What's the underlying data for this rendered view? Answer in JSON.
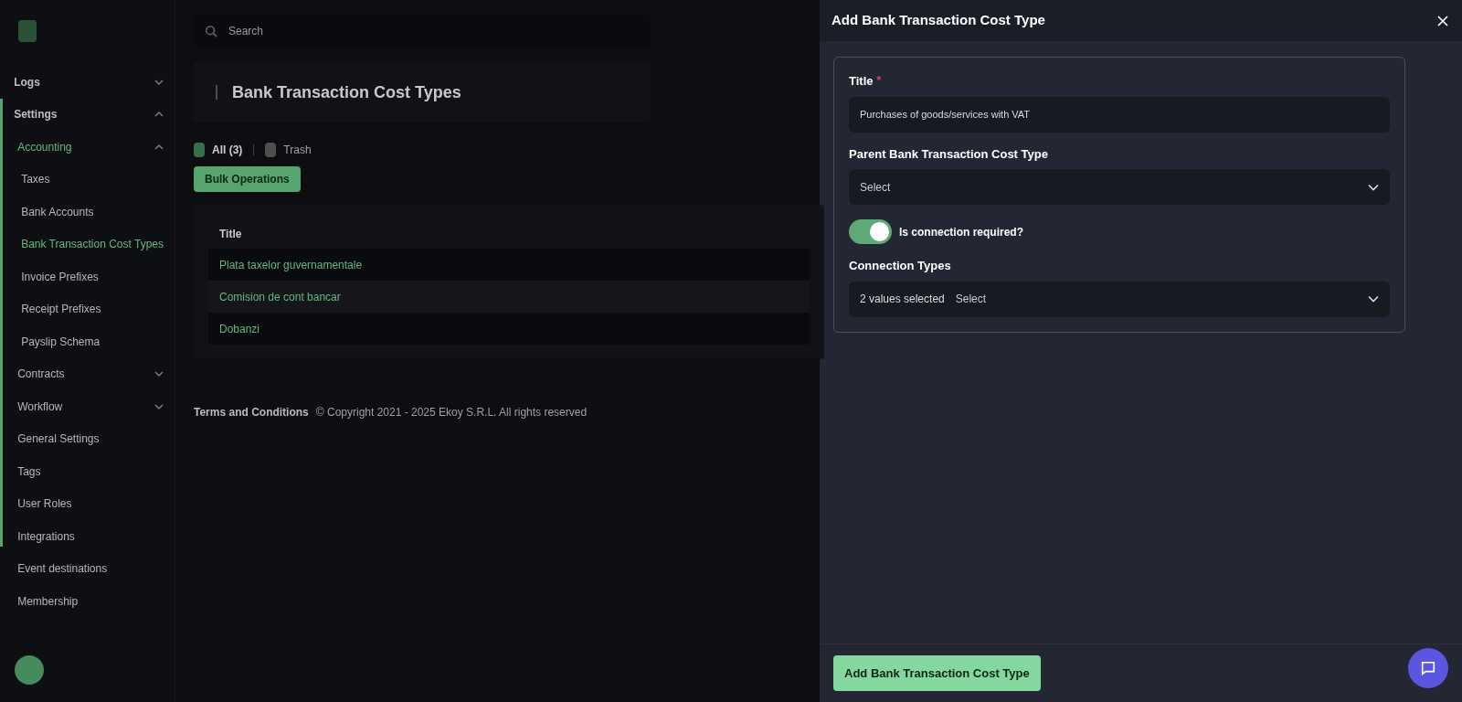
{
  "sidebar": {
    "items": [
      {
        "label": "Logs",
        "kind": "group",
        "expanded": false
      },
      {
        "label": "Settings",
        "kind": "group",
        "expanded": true,
        "children": [
          {
            "label": "Accounting",
            "kind": "subgroup",
            "expanded": true,
            "children": [
              {
                "label": "Taxes",
                "selected": false
              },
              {
                "label": "Bank Accounts",
                "selected": false
              },
              {
                "label": "Bank Transaction Cost Types",
                "selected": true
              },
              {
                "label": "Invoice Prefixes",
                "selected": false
              },
              {
                "label": "Receipt Prefixes",
                "selected": false
              },
              {
                "label": "Payslip Schema",
                "selected": false
              }
            ]
          },
          {
            "label": "Contracts",
            "kind": "subgroup",
            "expanded": false
          },
          {
            "label": "Workflow",
            "kind": "subgroup",
            "expanded": false
          },
          {
            "label": "General Settings",
            "kind": "link"
          },
          {
            "label": "Tags",
            "kind": "link"
          },
          {
            "label": "User Roles",
            "kind": "link"
          },
          {
            "label": "Integrations",
            "kind": "link"
          },
          {
            "label": "Event destinations",
            "kind": "link"
          },
          {
            "label": "Membership",
            "kind": "link"
          }
        ]
      }
    ]
  },
  "search": {
    "placeholder": "Search"
  },
  "page": {
    "title": "Bank Transaction Cost Types",
    "filters": [
      {
        "label": "All (3)",
        "selected": true
      },
      {
        "label": "Trash",
        "selected": false
      }
    ],
    "bulk_button": "Bulk Operations",
    "table": {
      "columns": [
        "Title"
      ],
      "rows": [
        "Plata taxelor guvernamentale",
        "Comision de cont bancar",
        "Dobanzi"
      ]
    },
    "footer": {
      "link": "Terms and Conditions",
      "copyright": "© Copyright 2021 - 2025 Ekoy S.R.L. All rights reserved"
    }
  },
  "drawer": {
    "title": "Add Bank Transaction Cost Type",
    "fields": [
      {
        "kind": "text",
        "label": "Title",
        "required_mark": "*",
        "value": "Purchases of goods/services with VAT"
      },
      {
        "kind": "select",
        "label": "Parent Bank Transaction Cost Type",
        "placeholder": "Select"
      },
      {
        "kind": "toggle",
        "label": "Is connection required?",
        "on": true
      },
      {
        "kind": "multiselect",
        "label": "Connection Types",
        "summary": "2 values selected",
        "placeholder": "Select"
      }
    ],
    "submit": "Add Bank Transaction Cost Type"
  }
}
